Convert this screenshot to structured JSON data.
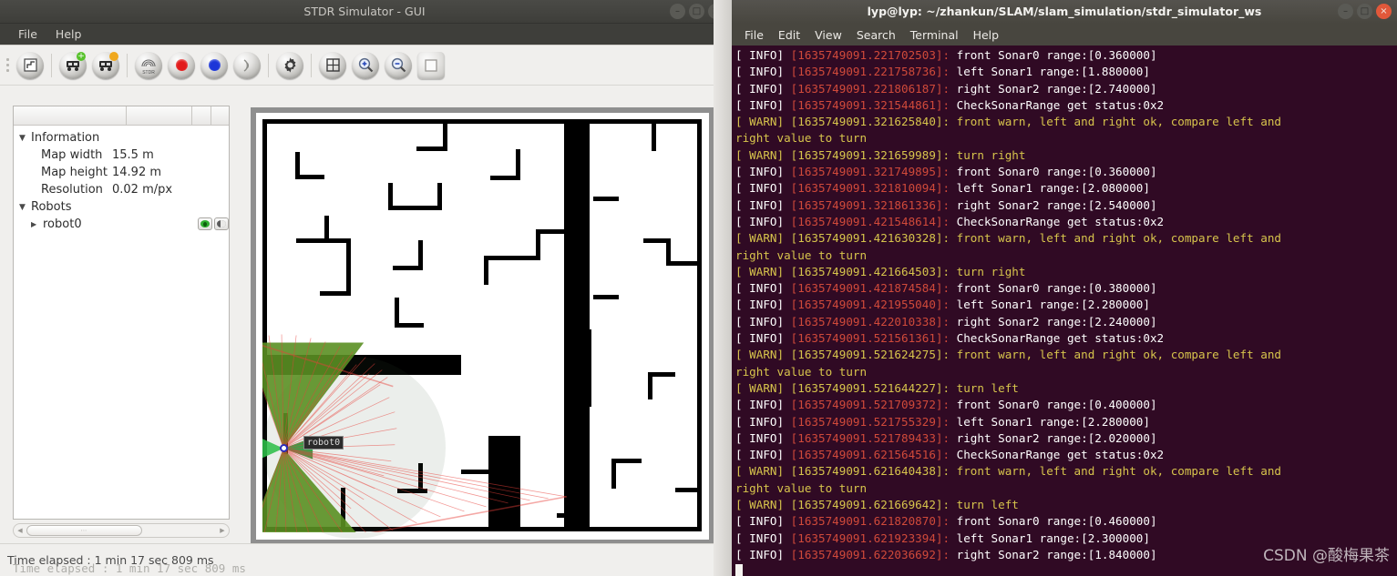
{
  "stdr": {
    "title": "STDR Simulator - GUI",
    "window_buttons": [
      {
        "name": "minimize",
        "glyph": "–"
      },
      {
        "name": "maximize",
        "glyph": "□"
      },
      {
        "name": "close",
        "glyph": "×"
      }
    ],
    "menu": [
      "File",
      "Help"
    ],
    "toolbar": [
      {
        "name": "load-map-icon",
        "kind": "map"
      },
      {
        "name": "add-robot-icon",
        "kind": "robot",
        "badge": "green"
      },
      {
        "name": "duplicate-robot-icon",
        "kind": "robot",
        "badge": "amber"
      },
      {
        "name": "stdr-logo-icon",
        "kind": "logo"
      },
      {
        "name": "record-icon",
        "kind": "dot-red"
      },
      {
        "name": "play-icon",
        "kind": "dot-blue"
      },
      {
        "name": "sonar-icon",
        "kind": "wave"
      },
      {
        "name": "properties-gear-icon",
        "kind": "gear"
      },
      {
        "name": "grid-icon",
        "kind": "grid"
      },
      {
        "name": "zoom-in-icon",
        "kind": "zoom-in"
      },
      {
        "name": "zoom-out-icon",
        "kind": "zoom-out"
      },
      {
        "name": "fit-view-icon",
        "kind": "square"
      }
    ],
    "tree": {
      "information_label": "Information",
      "rows": [
        {
          "key": "Map width",
          "value": "15.5 m"
        },
        {
          "key": "Map height",
          "value": "14.92 m"
        },
        {
          "key": "Resolution",
          "value": "0.02 m/px"
        }
      ],
      "robots_label": "Robots",
      "robot_name": "robot0"
    },
    "map": {
      "robot_label": "robot0"
    },
    "status": "Time elapsed : 1 min 17 sec 809 ms",
    "ghost_status": "Time elapsed : 1 min 17 sec 809 ms"
  },
  "terminal": {
    "title": "lyp@lyp: ~/zhankun/SLAM/slam_simulation/stdr_simulator_ws",
    "window_buttons": [
      {
        "name": "minimize",
        "glyph": "–"
      },
      {
        "name": "maximize",
        "glyph": "□"
      },
      {
        "name": "close",
        "glyph": "×"
      }
    ],
    "menu": [
      "File",
      "Edit",
      "View",
      "Search",
      "Terminal",
      "Help"
    ],
    "watermark": "CSDN @酸梅果茶",
    "colors": {
      "background": "#300a24",
      "info_tag": "#ffffff",
      "info_timestamp": "#d04a3a",
      "warn": "#d7c44c"
    },
    "lines": [
      {
        "level": "INFO",
        "tag": "[ INFO]",
        "ts": "[1635749091.221702503]:",
        "msg": " front Sonar0 range:[0.360000]"
      },
      {
        "level": "INFO",
        "tag": "[ INFO]",
        "ts": "[1635749091.221758736]:",
        "msg": " left Sonar1 range:[1.880000]"
      },
      {
        "level": "INFO",
        "tag": "[ INFO]",
        "ts": "[1635749091.221806187]:",
        "msg": " right Sonar2 range:[2.740000]"
      },
      {
        "level": "INFO",
        "tag": "[ INFO]",
        "ts": "[1635749091.321544861]:",
        "msg": " CheckSonarRange get status:0x2"
      },
      {
        "level": "WARN",
        "tag": "[ WARN]",
        "ts": "[1635749091.321625840]:",
        "msg": " front warn, left and right ok, compare left and"
      },
      {
        "level": "WARN",
        "tag": "",
        "ts": "",
        "msg": "right value to turn"
      },
      {
        "level": "WARN",
        "tag": "[ WARN]",
        "ts": "[1635749091.321659989]:",
        "msg": " turn right"
      },
      {
        "level": "INFO",
        "tag": "[ INFO]",
        "ts": "[1635749091.321749895]:",
        "msg": " front Sonar0 range:[0.360000]"
      },
      {
        "level": "INFO",
        "tag": "[ INFO]",
        "ts": "[1635749091.321810094]:",
        "msg": " left Sonar1 range:[2.080000]"
      },
      {
        "level": "INFO",
        "tag": "[ INFO]",
        "ts": "[1635749091.321861336]:",
        "msg": " right Sonar2 range:[2.540000]"
      },
      {
        "level": "INFO",
        "tag": "[ INFO]",
        "ts": "[1635749091.421548614]:",
        "msg": " CheckSonarRange get status:0x2"
      },
      {
        "level": "WARN",
        "tag": "[ WARN]",
        "ts": "[1635749091.421630328]:",
        "msg": " front warn, left and right ok, compare left and"
      },
      {
        "level": "WARN",
        "tag": "",
        "ts": "",
        "msg": "right value to turn"
      },
      {
        "level": "WARN",
        "tag": "[ WARN]",
        "ts": "[1635749091.421664503]:",
        "msg": " turn right"
      },
      {
        "level": "INFO",
        "tag": "[ INFO]",
        "ts": "[1635749091.421874584]:",
        "msg": " front Sonar0 range:[0.380000]"
      },
      {
        "level": "INFO",
        "tag": "[ INFO]",
        "ts": "[1635749091.421955040]:",
        "msg": " left Sonar1 range:[2.280000]"
      },
      {
        "level": "INFO",
        "tag": "[ INFO]",
        "ts": "[1635749091.422010338]:",
        "msg": " right Sonar2 range:[2.240000]"
      },
      {
        "level": "INFO",
        "tag": "[ INFO]",
        "ts": "[1635749091.521561361]:",
        "msg": " CheckSonarRange get status:0x2"
      },
      {
        "level": "WARN",
        "tag": "[ WARN]",
        "ts": "[1635749091.521624275]:",
        "msg": " front warn, left and right ok, compare left and"
      },
      {
        "level": "WARN",
        "tag": "",
        "ts": "",
        "msg": "right value to turn"
      },
      {
        "level": "WARN",
        "tag": "[ WARN]",
        "ts": "[1635749091.521644227]:",
        "msg": " turn left"
      },
      {
        "level": "INFO",
        "tag": "[ INFO]",
        "ts": "[1635749091.521709372]:",
        "msg": " front Sonar0 range:[0.400000]"
      },
      {
        "level": "INFO",
        "tag": "[ INFO]",
        "ts": "[1635749091.521755329]:",
        "msg": " left Sonar1 range:[2.280000]"
      },
      {
        "level": "INFO",
        "tag": "[ INFO]",
        "ts": "[1635749091.521789433]:",
        "msg": " right Sonar2 range:[2.020000]"
      },
      {
        "level": "INFO",
        "tag": "[ INFO]",
        "ts": "[1635749091.621564516]:",
        "msg": " CheckSonarRange get status:0x2"
      },
      {
        "level": "WARN",
        "tag": "[ WARN]",
        "ts": "[1635749091.621640438]:",
        "msg": " front warn, left and right ok, compare left and"
      },
      {
        "level": "WARN",
        "tag": "",
        "ts": "",
        "msg": "right value to turn"
      },
      {
        "level": "WARN",
        "tag": "[ WARN]",
        "ts": "[1635749091.621669642]:",
        "msg": " turn left"
      },
      {
        "level": "INFO",
        "tag": "[ INFO]",
        "ts": "[1635749091.621820870]:",
        "msg": " front Sonar0 range:[0.460000]"
      },
      {
        "level": "INFO",
        "tag": "[ INFO]",
        "ts": "[1635749091.621923394]:",
        "msg": " left Sonar1 range:[2.300000]"
      },
      {
        "level": "INFO",
        "tag": "[ INFO]",
        "ts": "[1635749091.622036692]:",
        "msg": " right Sonar2 range:[1.840000]"
      }
    ]
  }
}
